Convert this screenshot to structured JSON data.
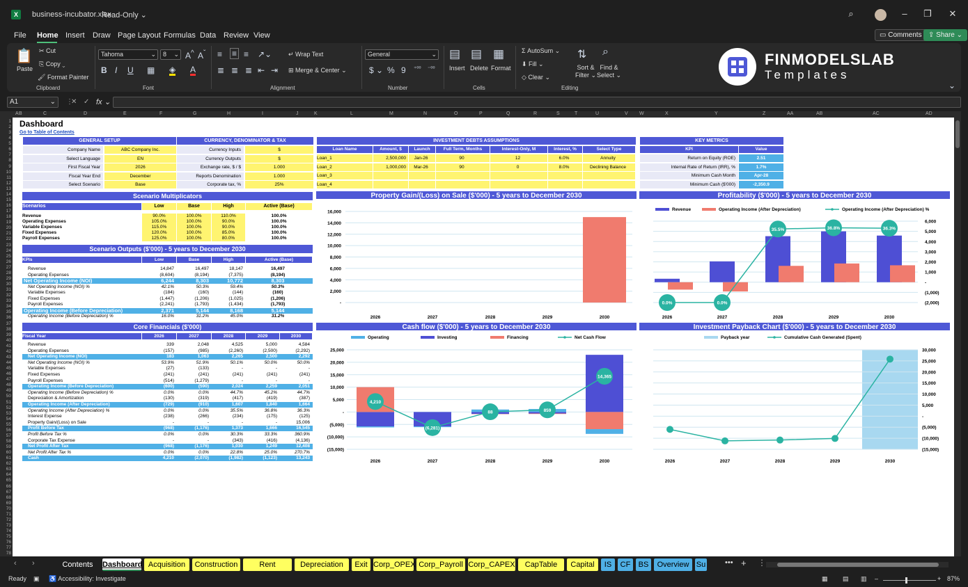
{
  "window": {
    "filename": "business-incubator.xlsx",
    "mode": "Read-Only"
  },
  "menu": [
    "File",
    "Home",
    "Insert",
    "Draw",
    "Page Layout",
    "Formulas",
    "Data",
    "Review",
    "View"
  ],
  "top_buttons": {
    "comments": "Comments",
    "share": "Share"
  },
  "ribbon": {
    "clipboard": {
      "paste": "Paste",
      "cut": "Cut",
      "copy": "Copy",
      "format_painter": "Format Painter",
      "group": "Clipboard"
    },
    "font": {
      "name": "Tahoma",
      "size": "8",
      "group": "Font",
      "bold": "B",
      "italic": "I",
      "underline": "U"
    },
    "alignment": {
      "wrap": "Wrap Text",
      "merge": "Merge & Center",
      "group": "Alignment"
    },
    "number": {
      "format": "General",
      "group": "Number",
      "currency": "$",
      "percent": "%",
      "comma": "9"
    },
    "cells": {
      "insert": "Insert",
      "delete": "Delete",
      "format": "Format",
      "group": "Cells"
    },
    "editing": {
      "autosum": "AutoSum",
      "fill": "Fill",
      "clear": "Clear",
      "sort": "Sort &",
      "filter": "Filter",
      "find": "Find &",
      "select": "Select",
      "group": "Editing"
    }
  },
  "logo": {
    "line1": "FINMODELSLAB",
    "line2": "Templates"
  },
  "formula_bar": {
    "cell": "A1",
    "fx": "fx"
  },
  "columns": [
    "A",
    "B",
    "C",
    "D",
    "E",
    "F",
    "G",
    "H",
    "I",
    "J",
    "K",
    "L",
    "M",
    "N",
    "O",
    "P",
    "Q",
    "R",
    "S",
    "T",
    "U",
    "V",
    "W",
    "X",
    "Y",
    "Z",
    "AA",
    "AB",
    "AC",
    "AD"
  ],
  "dashboard": {
    "title": "Dashboard",
    "toc_link": "Go to Table of Contents",
    "general_setup": {
      "title": "GENERAL SETUP",
      "rows": [
        [
          "Company Name",
          "ABC Company Inc."
        ],
        [
          "Select Language",
          "EN"
        ],
        [
          "First Fiscal Year",
          "2026"
        ],
        [
          "Fiscal Year End",
          "December"
        ],
        [
          "Select Scenario",
          "Base"
        ]
      ]
    },
    "currency": {
      "title": "CURRENCY, DENOMINATOR & TAX",
      "rows": [
        [
          "Currency Inputs",
          "$"
        ],
        [
          "Currency Outputs",
          "$"
        ],
        [
          "Exchange rate, $ / $",
          "1.000"
        ],
        [
          "Reports Denomination",
          "1.000"
        ],
        [
          "Corporate tax, %",
          "25%"
        ]
      ]
    },
    "debts": {
      "title": "INVESTMENT DEBTS ASSUMPTIONS",
      "headers": [
        "Loan Name",
        "Amount, $",
        "Launch",
        "Full Term, Months",
        "Interest-Only, M",
        "Interest, %",
        "Select Type"
      ],
      "rows": [
        [
          "Loan_1",
          "2,500,000",
          "Jan-26",
          "90",
          "12",
          "6.0%",
          "Annuity"
        ],
        [
          "Loan_2",
          "1,000,000",
          "Mar-26",
          "90",
          "0",
          "8.0%",
          "Declining Balance"
        ],
        [
          "Loan_3",
          "",
          "",
          "",
          "",
          "",
          ""
        ],
        [
          "Loan_4",
          "",
          "",
          "",
          "",
          "",
          ""
        ]
      ]
    },
    "key_metrics": {
      "title": "KEY METRICS",
      "headers": [
        "KPI",
        "Value"
      ],
      "rows": [
        [
          "Return on Equity (ROE)",
          "2.51"
        ],
        [
          "Internal Rate of Return (IRR), %",
          "1.7%"
        ],
        [
          "Minimum Cash Month",
          "Apr-28"
        ],
        [
          "Minimum Cash ($'000)",
          "-2,350.9"
        ]
      ]
    },
    "scenario_mult": {
      "title": "Scenario Multiplicators",
      "headers": [
        "Scenarios",
        "Low",
        "Base",
        "High",
        "Active (Base)"
      ],
      "rows": [
        [
          "Revenue",
          "90.0%",
          "100.0%",
          "110.0%",
          "100.0%"
        ],
        [
          "Operating Expenses",
          "105.0%",
          "100.0%",
          "90.0%",
          "100.0%"
        ],
        [
          "Variable Expenses",
          "115.0%",
          "100.0%",
          "90.0%",
          "100.0%"
        ],
        [
          "Fixed Expenses",
          "120.0%",
          "100.0%",
          "85.0%",
          "100.0%"
        ],
        [
          "Payroll Expenses",
          "125.0%",
          "100.0%",
          "80.0%",
          "100.0%"
        ]
      ]
    },
    "scenario_out": {
      "title": "Scenario Outputs ($'000) - 5 years to December 2030",
      "headers": [
        "KPIs",
        "Low",
        "Base",
        "High",
        "Active (Base)"
      ],
      "rows": [
        [
          "Revenue",
          "14,847",
          "16,497",
          "18,147",
          "16,497",
          ""
        ],
        [
          "Operating Expenses",
          "(8,604)",
          "(8,194)",
          "(7,375)",
          "(8,194)",
          ""
        ],
        [
          "Net Operating Income (NOI)",
          "6,244",
          "8,303",
          "10,772",
          "8,303",
          "hl"
        ],
        [
          "Net Operating Income (NOI) %",
          "42.1%",
          "50.3%",
          "59.4%",
          "50.3%",
          "it"
        ],
        [
          "Variable Expenses",
          "(184)",
          "(160)",
          "(144)",
          "(160)",
          ""
        ],
        [
          "Fixed Expenses",
          "(1,447)",
          "(1,206)",
          "(1,025)",
          "(1,206)",
          ""
        ],
        [
          "Payroll Expenses",
          "(2,241)",
          "(1,793)",
          "(1,434)",
          "(1,793)",
          ""
        ],
        [
          "Operating Income (Before Depreciation)",
          "2,371",
          "5,144",
          "8,168",
          "5,144",
          "hl"
        ],
        [
          "Operating Income (Before Depreciation) %",
          "16.0%",
          "31.2%",
          "45.0%",
          "31.2%",
          "it"
        ]
      ]
    },
    "core": {
      "title": "Core Financials ($'000)",
      "headers": [
        "Fiscal Year",
        "2026",
        "2027",
        "2028",
        "2029",
        "2030"
      ],
      "rows": [
        [
          "Revenue",
          "339",
          "2,048",
          "4,525",
          "5,000",
          "4,584",
          ""
        ],
        [
          "Operating Expenses",
          "(157)",
          "(985)",
          "(2,260)",
          "(2,500)",
          "(2,292)",
          ""
        ],
        [
          "Net Operating Income (NOI)",
          "183",
          "1,063",
          "2,265",
          "2,500",
          "2,292",
          "hl"
        ],
        [
          "Net Operating Income (NOI) %",
          "53.9%",
          "51.9%",
          "50.1%",
          "50.0%",
          "50.0%",
          "it"
        ],
        [
          "Variable Expenses",
          "(27)",
          "(133)",
          "-",
          "-",
          "-",
          ""
        ],
        [
          "Fixed Expenses",
          "(241)",
          "(241)",
          "(241)",
          "(241)",
          "(241)",
          ""
        ],
        [
          "Payroll Expenses",
          "(514)",
          "(1,279)",
          "-",
          "-",
          "-",
          ""
        ],
        [
          "Operating Income (Before Depreciation)",
          "(600)",
          "(590)",
          "2,024",
          "2,259",
          "2,051",
          "hl"
        ],
        [
          "Operating Income (Before Depreciation) %",
          "0.0%",
          "0.0%",
          "44.7%",
          "45.2%",
          "44.7%",
          "it"
        ],
        [
          "Depreciation & Amortization",
          "(130)",
          "(319)",
          "(417)",
          "(419)",
          "(387)",
          ""
        ],
        [
          "Operating Income (After Depreciation)",
          "(729)",
          "(910)",
          "1,607",
          "1,840",
          "1,664",
          "hl"
        ],
        [
          "Operating Income (After Depreciation) %",
          "0.0%",
          "0.0%",
          "35.5%",
          "36.8%",
          "36.3%",
          "it"
        ],
        [
          "Interest Expense",
          "(238)",
          "(266)",
          "(234)",
          "(175)",
          "(125)",
          ""
        ],
        [
          "Property Gain/(Loss) on Sale",
          "-",
          "-",
          "-",
          "-",
          "15,006",
          ""
        ],
        [
          "Profit Before Tax",
          "(968)",
          "(1,176)",
          "1,373",
          "1,666",
          "16,545",
          "hl"
        ],
        [
          "Profit Before Tax %",
          "0.0%",
          "0.0%",
          "30.3%",
          "33.3%",
          "360.9%",
          "it"
        ],
        [
          "Corporate Tax Expense",
          "-",
          "-",
          "(343)",
          "(416)",
          "(4,136)",
          ""
        ],
        [
          "Net Profit After Tax",
          "(968)",
          "(1,176)",
          "1,030",
          "1,249",
          "12,408",
          "hl"
        ],
        [
          "Net Profit After Tax %",
          "0.0%",
          "0.0%",
          "22.8%",
          "25.0%",
          "270.7%",
          "it"
        ],
        [
          "Cash",
          "4,210",
          "(2,070)",
          "(1,982)",
          "(1,123)",
          "13,243",
          "hl"
        ]
      ]
    }
  },
  "chart_data": [
    {
      "type": "bar",
      "title": "Property Gain/(Loss) on Sale ($'000) - 5 years to December 2030",
      "categories": [
        "2026",
        "2027",
        "2028",
        "2029",
        "2030"
      ],
      "values": [
        0,
        0,
        0,
        0,
        15006
      ],
      "ylim": [
        0,
        16000
      ],
      "yticks": [
        "16,000",
        "14,000",
        "12,000",
        "10,000",
        "8,000",
        "6,000",
        "4,000",
        "2,000",
        "-"
      ],
      "color": "#f07b6e"
    },
    {
      "type": "bar",
      "title": "Profitability ($'000) - 5 years to December 2030",
      "categories": [
        "2026",
        "2027",
        "2028",
        "2029",
        "2030"
      ],
      "series": [
        {
          "name": "Revenue",
          "values": [
            339,
            2048,
            4525,
            5000,
            4584
          ],
          "color": "#4e4fd4"
        },
        {
          "name": "Operating Income (After Depreciation)",
          "values": [
            -729,
            -910,
            1607,
            1840,
            1664
          ],
          "color": "#f07b6e"
        },
        {
          "name": "Operating Income (After Depreciation) %",
          "values": [
            0.0,
            0.0,
            35.5,
            36.8,
            36.3
          ],
          "labels": [
            "0.0%",
            "0.0%",
            "35.5%",
            "36.8%",
            "36.3%"
          ],
          "color": "#2ab3a2"
        }
      ],
      "ylim": [
        -2000,
        6000
      ],
      "yticks": [
        "6,000",
        "5,000",
        "4,000",
        "3,000",
        "2,000",
        "1,000",
        "-",
        "(1,000)",
        "(2,000)"
      ]
    },
    {
      "type": "bar",
      "title": "Cash flow ($'000) - 5 years to December 2030",
      "categories": [
        "2026",
        "2027",
        "2028",
        "2029",
        "2030"
      ],
      "series": [
        {
          "name": "Operating",
          "values": [
            -400,
            -300,
            1000,
            1200,
            -1900
          ],
          "color": "#4fb0e6"
        },
        {
          "name": "Investing",
          "values": [
            -5800,
            -5800,
            -800,
            -600,
            23000
          ],
          "color": "#4e4fd4"
        },
        {
          "name": "Financing",
          "values": [
            10000,
            0,
            -100,
            -200,
            -6900
          ],
          "color": "#f07b6e"
        },
        {
          "name": "Net Cash Flow",
          "values": [
            4210,
            -6281,
            88,
            859,
            14365
          ],
          "labels": [
            "4,210",
            "(6,281)",
            "88",
            "859",
            "14,365"
          ],
          "color": "#2ab3a2"
        }
      ],
      "ylim": [
        -15000,
        25000
      ],
      "yticks": [
        "25,000",
        "20,000",
        "15,000",
        "10,000",
        "5,000",
        "-",
        "(5,000)",
        "(10,000)",
        "(15,000)"
      ]
    },
    {
      "type": "line",
      "title": "Investment Payback Chart ($'000) - 5 years to December 2030",
      "categories": [
        "2026",
        "2027",
        "2028",
        "2029",
        "2030"
      ],
      "series": [
        {
          "name": "Payback year",
          "values": [
            0,
            0,
            0,
            0,
            1
          ],
          "color": "#a8d8f0"
        },
        {
          "name": "Cumulative Cash Generated (Spent)",
          "values": [
            -6000,
            -11200,
            -10800,
            -10100,
            25800
          ],
          "color": "#2ab3a2"
        }
      ],
      "ylim": [
        -15000,
        30000
      ],
      "yticks": [
        "30,000",
        "25,000",
        "20,000",
        "15,000",
        "10,000",
        "5,000",
        "-",
        "(5,000)",
        "(10,000)",
        "(15,000)"
      ]
    }
  ],
  "tabs": [
    {
      "label": "Contents",
      "style": "dark"
    },
    {
      "label": "Dashboard",
      "style": "active"
    },
    {
      "label": "Acquisition",
      "style": "yellow"
    },
    {
      "label": "Construction",
      "style": "yellow"
    },
    {
      "label": "Rent Revenue",
      "style": "yellow"
    },
    {
      "label": "Depreciation",
      "style": "yellow"
    },
    {
      "label": "Exit",
      "style": "yellow"
    },
    {
      "label": "Corp_OPEX",
      "style": "yellow"
    },
    {
      "label": "Corp_Payroll",
      "style": "yellow"
    },
    {
      "label": "Corp_CAPEX",
      "style": "yellow"
    },
    {
      "label": "CapTable",
      "style": "yellow"
    },
    {
      "label": "Capital",
      "style": "yellow"
    },
    {
      "label": "IS",
      "style": "blue"
    },
    {
      "label": "CF",
      "style": "blue"
    },
    {
      "label": "BS",
      "style": "blue"
    },
    {
      "label": "Overview",
      "style": "blue"
    },
    {
      "label": "Su",
      "style": "blue"
    }
  ],
  "status": {
    "ready": "Ready",
    "accessibility": "Accessibility: Investigate",
    "zoom": "87%"
  }
}
